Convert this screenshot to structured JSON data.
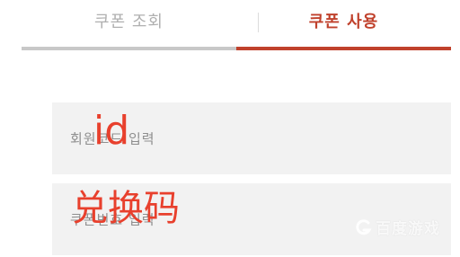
{
  "tabs": [
    {
      "label": "쿠폰 조회",
      "active": false
    },
    {
      "label": "쿠폰 사용",
      "active": true
    }
  ],
  "colors": {
    "accent": "#c0412c",
    "inactive_tab_text": "#b0b0b0",
    "inactive_tab_line": "#c8c8c8",
    "field_bg": "#f2f2f2",
    "overlay_text": "#e8402d"
  },
  "form": {
    "member_code": {
      "placeholder": "회원코드 입력",
      "value": ""
    },
    "coupon_code": {
      "placeholder": "쿠폰번호 입력",
      "value": ""
    }
  },
  "annotations": {
    "member_code_label": "id",
    "coupon_code_label": "兑换码"
  },
  "watermark": {
    "text": "百度游戏",
    "icon": "baidu-logo-icon"
  }
}
